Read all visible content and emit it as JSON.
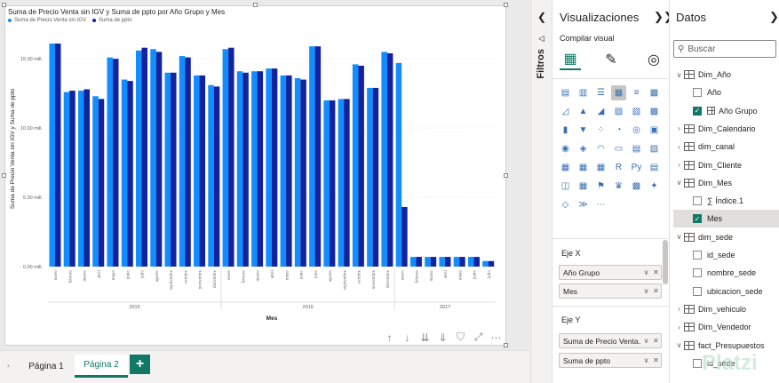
{
  "visual": {
    "title": "Suma de Precio Venta sin IGV y Suma de ppto por Año Grupo y Mes",
    "legend": [
      {
        "label": "Suma de Precio Venta sin IGV",
        "color": "#118dff"
      },
      {
        "label": "Suma de ppto",
        "color": "#12239e"
      }
    ]
  },
  "chart_data": {
    "type": "bar",
    "title": "Suma de Precio Venta sin IGV y Suma de ppto por Año Grupo y Mes",
    "xlabel": "Mes",
    "ylabel": "Suma de Precio Venta sin IGV y Suma de ppto",
    "ylim": [
      0,
      17000000
    ],
    "y_ticks": [
      {
        "value": 0,
        "label": "0.00 mill."
      },
      {
        "value": 5000000,
        "label": "5.00 mill."
      },
      {
        "value": 10000000,
        "label": "10.00 mill."
      },
      {
        "value": 15000000,
        "label": "15.00 mill."
      }
    ],
    "groups": [
      {
        "label": "2015",
        "start": 0,
        "count": 12
      },
      {
        "label": "2016",
        "start": 12,
        "count": 12
      },
      {
        "label": "2017",
        "start": 24,
        "count": 7
      }
    ],
    "categories": [
      "enero",
      "febrero",
      "marzo",
      "abril",
      "mayo",
      "junio",
      "julio",
      "agosto",
      "septiembre",
      "octubre",
      "noviembre",
      "diciembre",
      "enero",
      "febrero",
      "marzo",
      "abril",
      "mayo",
      "junio",
      "julio",
      "agosto",
      "septiembre",
      "octubre",
      "noviembre",
      "diciembre",
      "enero",
      "febrero",
      "marzo",
      "abril",
      "mayo",
      "junio",
      "julio"
    ],
    "series": [
      {
        "name": "Suma de Precio Venta sin IGV",
        "color": "#118dff",
        "values": [
          16100000,
          12600000,
          12700000,
          12300000,
          15100000,
          13500000,
          15600000,
          15700000,
          14000000,
          15200000,
          13800000,
          13100000,
          15700000,
          14100000,
          14100000,
          14300000,
          13800000,
          13600000,
          15900000,
          12000000,
          12100000,
          14600000,
          12900000,
          15500000,
          14700000,
          700000,
          700000,
          700000,
          700000,
          700000,
          400000
        ]
      },
      {
        "name": "Suma de ppto",
        "color": "#12239e",
        "values": [
          16100000,
          12700000,
          12800000,
          12100000,
          15000000,
          13400000,
          15800000,
          15500000,
          14000000,
          15100000,
          13800000,
          13000000,
          15800000,
          14000000,
          14100000,
          14300000,
          13800000,
          13500000,
          15900000,
          12000000,
          12100000,
          14500000,
          12900000,
          15400000,
          4300000,
          700000,
          700000,
          700000,
          700000,
          700000,
          400000
        ]
      }
    ]
  },
  "pages": {
    "tabs": [
      "Página 1",
      "Página 2"
    ],
    "active": 1,
    "add_label": "+"
  },
  "toolbar": {
    "icons": [
      "arrow-up-icon",
      "arrow-down-icon",
      "drill-down-icon",
      "expand-icon",
      "filter-icon",
      "focus-icon",
      "more-icon"
    ],
    "glyphs": [
      "↑",
      "↓",
      "⇊",
      "⇓",
      "⛉",
      "⤢",
      "⋯"
    ]
  },
  "filters": {
    "label": "Filtros"
  },
  "viz": {
    "title": "Visualizaciones",
    "subtitle": "Compilar visual",
    "x_label": "Eje X",
    "x_fields": [
      "Año Grupo",
      "Mes"
    ],
    "y_label": "Eje Y",
    "y_fields": [
      "Suma de Precio Venta...",
      "Suma de ppto"
    ],
    "more": "⋯"
  },
  "data": {
    "title": "Datos",
    "search_placeholder": "Buscar",
    "tree": [
      {
        "label": "Dim_Año",
        "level": 0,
        "type": "table",
        "expanded": true
      },
      {
        "label": "Año",
        "level": 1,
        "type": "field",
        "checked": false
      },
      {
        "label": "Año Grupo",
        "level": 1,
        "type": "group",
        "checked": true
      },
      {
        "label": "Dim_Calendario",
        "level": 0,
        "type": "table",
        "expanded": false
      },
      {
        "label": "dim_canal",
        "level": 0,
        "type": "table",
        "expanded": false
      },
      {
        "label": "Dim_Cliente",
        "level": 0,
        "type": "table",
        "expanded": false
      },
      {
        "label": "Dim_Mes",
        "level": 0,
        "type": "table",
        "expanded": true
      },
      {
        "label": "Índice.1",
        "level": 1,
        "type": "sigma",
        "checked": false
      },
      {
        "label": "Mes",
        "level": 1,
        "type": "field",
        "checked": true,
        "selected": true
      },
      {
        "label": "dim_sede",
        "level": 0,
        "type": "table",
        "expanded": true
      },
      {
        "label": "id_sede",
        "level": 1,
        "type": "field",
        "checked": false
      },
      {
        "label": "nombre_sede",
        "level": 1,
        "type": "field",
        "checked": false
      },
      {
        "label": "ubicacion_sede",
        "level": 1,
        "type": "field",
        "checked": false
      },
      {
        "label": "Dim_vehiculo",
        "level": 0,
        "type": "table",
        "expanded": false
      },
      {
        "label": "Dim_Vendedor",
        "level": 0,
        "type": "table",
        "expanded": false
      },
      {
        "label": "fact_Presupuestos",
        "level": 0,
        "type": "table",
        "expanded": true
      },
      {
        "label": "id_sede",
        "level": 1,
        "type": "field",
        "checked": false
      }
    ]
  },
  "watermark": "Platzi"
}
